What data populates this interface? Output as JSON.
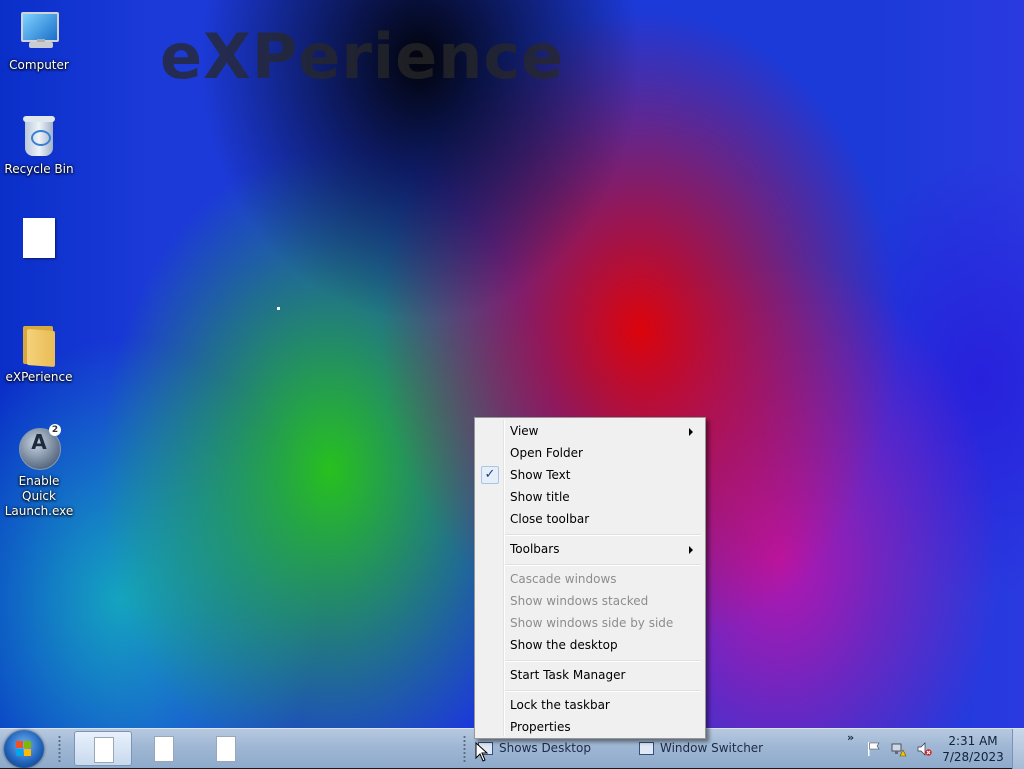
{
  "wallpaper": {
    "title": "eXPerience"
  },
  "desktop_icons": [
    {
      "label": "Computer",
      "icon": "computer-icon"
    },
    {
      "label": "Recycle Bin",
      "icon": "recycle-bin-icon"
    },
    {
      "label": "",
      "icon": "document-icon"
    },
    {
      "label": "eXPerience",
      "icon": "folder-icon"
    },
    {
      "label": "Enable Quick Launch.exe",
      "icon": "quick-launch-icon"
    }
  ],
  "context_menu": {
    "items": [
      {
        "label": "View",
        "submenu": true
      },
      {
        "label": "Open Folder"
      },
      {
        "label": "Show Text",
        "checked": true
      },
      {
        "label": "Show title"
      },
      {
        "label": "Close toolbar"
      },
      {
        "label": "Toolbars",
        "submenu": true
      },
      {
        "label": "Cascade windows",
        "disabled": true
      },
      {
        "label": "Show windows stacked",
        "disabled": true
      },
      {
        "label": "Show windows side by side",
        "disabled": true
      },
      {
        "label": "Show the desktop"
      },
      {
        "label": "Start Task Manager"
      },
      {
        "label": "Lock the taskbar"
      },
      {
        "label": "Properties"
      }
    ],
    "check_glyph": "✓"
  },
  "taskbar": {
    "toolbar_buttons": [
      {
        "label": "Shows Desktop"
      },
      {
        "label": "Window Switcher"
      }
    ],
    "chevron": "»",
    "clock": {
      "time": "2:31 AM",
      "date": "7/28/2023"
    },
    "tray_icons": [
      "action-center-flag-icon",
      "network-warning-icon",
      "volume-muted-icon"
    ]
  },
  "colors": {
    "taskbar": "#9fb7d4",
    "menu_background": "#f0f0f0",
    "disabled_text": "#8d8d8d"
  }
}
